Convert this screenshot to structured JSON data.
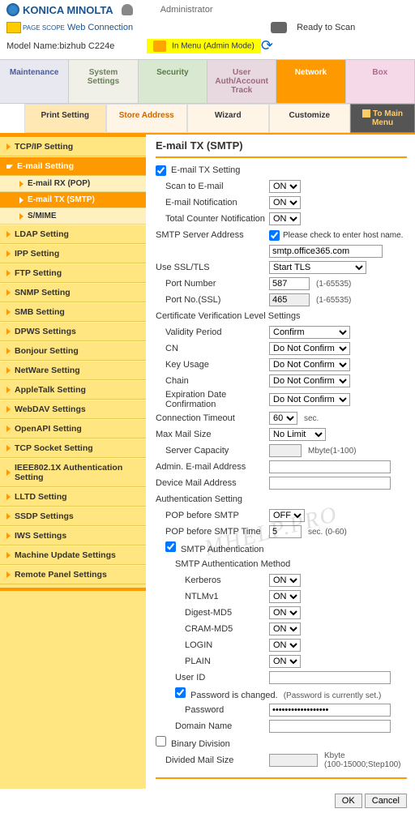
{
  "brand": "KONICA MINOLTA",
  "admin_label": "Administrator",
  "page_scope": "Web Connection",
  "page_scope_prefix": "PAGE SCOPE",
  "ready_scan": "Ready to Scan",
  "model_label": "Model Name:",
  "model_value": "bizhub C224e",
  "admin_mode": "In Menu (Admin Mode)",
  "tabs1": {
    "maintenance": "Maintenance",
    "system": "System Settings",
    "security": "Security",
    "userauth": "User Auth/Account Track",
    "network": "Network",
    "box": "Box"
  },
  "tabs2": {
    "print": "Print Setting",
    "store": "Store Address",
    "wizard": "Wizard",
    "customize": "Customize",
    "tomain": "To Main Menu"
  },
  "sidebar": [
    "TCP/IP Setting",
    "E-mail Setting",
    "LDAP Setting",
    "IPP Setting",
    "FTP Setting",
    "SNMP Setting",
    "SMB Setting",
    "DPWS Settings",
    "Bonjour Setting",
    "NetWare Setting",
    "AppleTalk Setting",
    "WebDAV Settings",
    "OpenAPI Setting",
    "TCP Socket Setting",
    "IEEE802.1X Authentication Setting",
    "LLTD Setting",
    "SSDP Settings",
    "IWS Settings",
    "Machine Update Settings",
    "Remote Panel Settings"
  ],
  "subsidebar": [
    "E-mail RX (POP)",
    "E-mail TX (SMTP)",
    "S/MIME"
  ],
  "section_title": "E-mail TX (SMTP)",
  "form": {
    "emailtx": "E-mail TX Setting",
    "scan2email": "Scan to E-mail",
    "scan2email_v": "ON",
    "emailnotif": "E-mail Notification",
    "emailnotif_v": "ON",
    "totalcounter": "Total Counter Notification",
    "totalcounter_v": "ON",
    "smtpaddr": "SMTP Server Address",
    "hostname_check": "Please check to enter host name.",
    "smtpaddr_v": "smtp.office365.com",
    "ssltls": "Use SSL/TLS",
    "ssltls_v": "Start TLS",
    "portn": "Port Number",
    "portn_v": "587",
    "port_range": "(1-65535)",
    "portssl": "Port No.(SSL)",
    "portssl_v": "465",
    "certlvl": "Certificate Verification Level Settings",
    "validity": "Validity Period",
    "validity_v": "Confirm",
    "cn": "CN",
    "cn_v": "Do Not Confirm",
    "keyusage": "Key Usage",
    "keyusage_v": "Do Not Confirm",
    "chain": "Chain",
    "chain_v": "Do Not Confirm",
    "expdate": "Expiration Date Confirmation",
    "expdate_v": "Do Not Confirm",
    "conntimeout": "Connection Timeout",
    "conntimeout_v": "60",
    "sec": "sec.",
    "maxmail": "Max Mail Size",
    "maxmail_v": "No Limit",
    "servercap": "Server Capacity",
    "servercap_v": "",
    "mbyte": "Mbyte(1-100)",
    "adminmail": "Admin. E-mail Address",
    "adminmail_v": "",
    "devicemail": "Device Mail Address",
    "devicemail_v": "",
    "authsetting": "Authentication Setting",
    "popbefore": "POP before SMTP",
    "popbefore_v": "OFF",
    "poptime": "POP before SMTP Time",
    "poptime_v": "5",
    "poptime_hint": "sec. (0-60)",
    "smtpauth": "SMTP Authentication",
    "smtpauthmethod": "SMTP Authentication Method",
    "kerberos": "Kerberos",
    "kerberos_v": "ON",
    "ntlmv1": "NTLMv1",
    "ntlmv1_v": "ON",
    "digest": "Digest-MD5",
    "digest_v": "ON",
    "cram": "CRAM-MD5",
    "cram_v": "ON",
    "login": "LOGIN",
    "login_v": "ON",
    "plain": "PLAIN",
    "plain_v": "ON",
    "userid": "User ID",
    "userid_v": "",
    "pwchanged": "Password is changed.",
    "pwset": "(Password is currently set.)",
    "password": "Password",
    "password_v": "••••••••••••••••••",
    "domain": "Domain Name",
    "domain_v": "",
    "binarydiv": "Binary Division",
    "divsize": "Divided Mail Size",
    "divsize_v": "",
    "divsize_hint": "Kbyte\n(100-15000;Step100)"
  },
  "buttons": {
    "ok": "OK",
    "cancel": "Cancel"
  },
  "watermark": "MHELP.PRO"
}
